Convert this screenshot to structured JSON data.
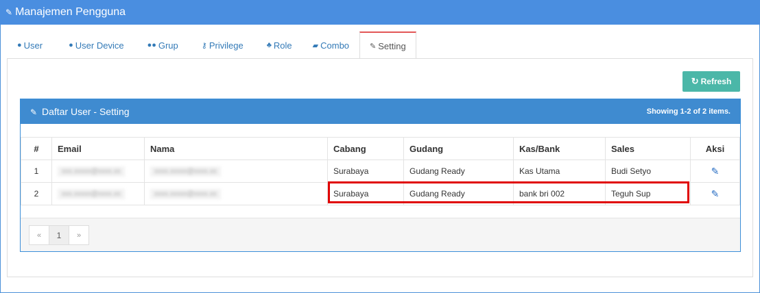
{
  "window": {
    "title": "Manajemen Pengguna"
  },
  "tabs": [
    {
      "label": "User",
      "icon": "user-icon"
    },
    {
      "label": "User Device",
      "icon": "user-icon"
    },
    {
      "label": "Grup",
      "icon": "users-icon"
    },
    {
      "label": "Privilege",
      "icon": "key-icon"
    },
    {
      "label": "Role",
      "icon": "user-shield-icon"
    },
    {
      "label": "Combo",
      "icon": "book-icon"
    },
    {
      "label": "Setting",
      "icon": "edit-icon",
      "active": true
    }
  ],
  "toolbar": {
    "refresh_label": "Refresh"
  },
  "panel": {
    "title": "Daftar User - Setting",
    "summary": "Showing 1-2 of 2 items."
  },
  "table": {
    "headers": [
      "#",
      "Email",
      "Nama",
      "Cabang",
      "Gudang",
      "Kas/Bank",
      "Sales",
      "Aksi"
    ],
    "rows": [
      {
        "no": "1",
        "email": "xxx.xxxxx@xxxx.xx",
        "nama": "xxxx.xxxxx@xxxx.xx",
        "cabang": "Surabaya",
        "gudang": "Gudang Ready",
        "kas_bank": "Kas Utama",
        "sales": "Budi Setyo"
      },
      {
        "no": "2",
        "email": "xxx.xxxxx@xxxx.xx",
        "nama": "xxxx.xxxxx@xxxx.xx",
        "cabang": "Surabaya",
        "gudang": "Gudang Ready",
        "kas_bank": "bank bri 002",
        "sales": "Teguh Sup"
      }
    ]
  },
  "pagination": {
    "prev": "«",
    "current": "1",
    "next": "»"
  },
  "colors": {
    "header": "#4a8ee0",
    "panel": "#3f8bd0",
    "refresh": "#4bb7a8",
    "highlight": "#e00000"
  }
}
